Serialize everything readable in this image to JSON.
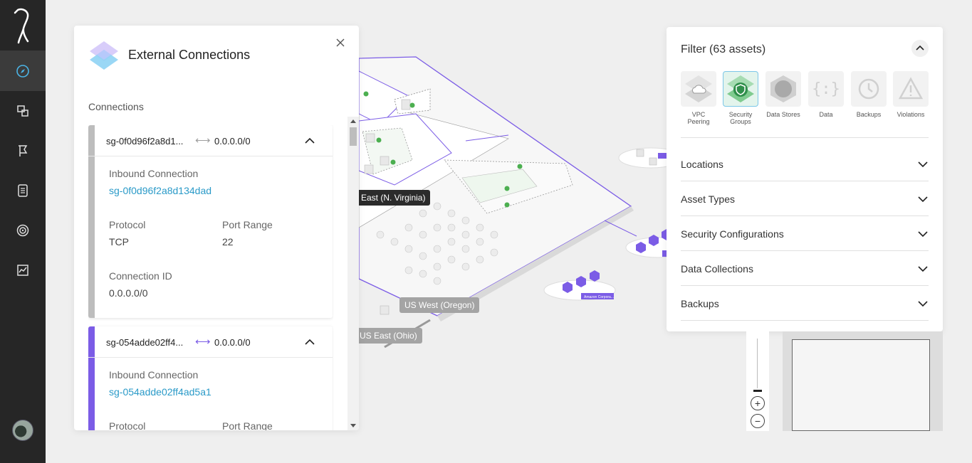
{
  "panel": {
    "title": "External Connections",
    "section_label": "Connections",
    "connections": [
      {
        "source_short": "sg-0f0d96f2a8d1...",
        "destination": "0.0.0.0/0",
        "accent_color": "#bdbdbd",
        "arrow_color": "#9e9e9e",
        "inbound_label": "Inbound Connection",
        "inbound_value": "sg-0f0d96f2a8d134dad",
        "protocol_label": "Protocol",
        "protocol_value": "TCP",
        "port_label": "Port Range",
        "port_value": "22",
        "conn_id_label": "Connection ID",
        "conn_id_value": "0.0.0.0/0"
      },
      {
        "source_short": "sg-054adde02ff4...",
        "destination": "0.0.0.0/0",
        "accent_color": "#7b5ce6",
        "arrow_color": "#7b5ce6",
        "inbound_label": "Inbound Connection",
        "inbound_value": "sg-054adde02ff4ad5a1",
        "protocol_label": "Protocol",
        "port_label": "Port Range"
      }
    ]
  },
  "map": {
    "regions": [
      {
        "label": "East (N. Virginia)",
        "style": "dark"
      },
      {
        "label": "US West (Oregon)",
        "style": "grey"
      },
      {
        "label": "US East (Ohio)",
        "style": "grey"
      }
    ],
    "tag": "Amazon Corpora..."
  },
  "filter": {
    "title": "Filter (63 assets)",
    "asset_types": [
      {
        "label": "VPC Peering",
        "icon": "cloud-icon",
        "selected": false
      },
      {
        "label": "Security Groups",
        "icon": "shield-icon",
        "selected": true
      },
      {
        "label": "Data Stores",
        "icon": "data-store-icon",
        "selected": false
      },
      {
        "label": "Data",
        "icon": "braces-icon",
        "selected": false
      },
      {
        "label": "Backups",
        "icon": "backup-clock-icon",
        "selected": false
      },
      {
        "label": "Violations",
        "icon": "warning-icon",
        "selected": false
      }
    ],
    "sections": [
      "Locations",
      "Asset Types",
      "Security Configurations",
      "Data Collections",
      "Backups"
    ]
  },
  "colors": {
    "sidebar_bg": "#262626",
    "link": "#2a9ac8",
    "accent_purple": "#7b5ce6",
    "nav_active_icon": "#4bb4e6",
    "security_green": "#4caf50"
  }
}
